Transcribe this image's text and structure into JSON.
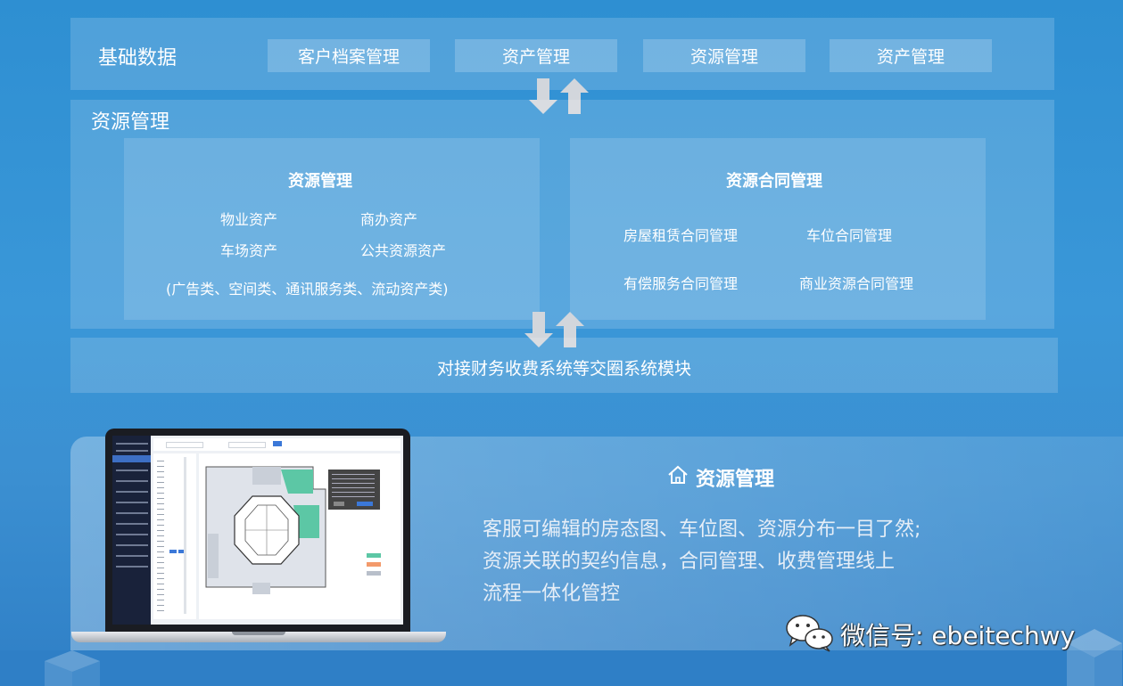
{
  "top_section": {
    "title": "基础数据",
    "chips": [
      "客户档案管理",
      "资产管理",
      "资源管理",
      "资产管理"
    ]
  },
  "middle_section": {
    "title": "资源管理",
    "left_card": {
      "title": "资源管理",
      "items": [
        "物业资产",
        "商办资产",
        "车场资产",
        "公共资源资产"
      ],
      "note": "(广告类、空间类、通讯服务类、流动资产类)"
    },
    "right_card": {
      "title": "资源合同管理",
      "items": [
        "房屋租赁合同管理",
        "车位合同管理",
        "有偿服务合同管理",
        "商业资源合同管理"
      ]
    }
  },
  "bottom_bar": {
    "label": "对接财务收费系统等交圈系统模块"
  },
  "feature": {
    "icon": "home-icon",
    "title": "资源管理",
    "description_lines": [
      "客服可编辑的房态图、车位图、资源分布一目了然;",
      "资源关联的契约信息，合同管理、收费管理线上",
      "流程一体化管控"
    ]
  },
  "watermark": {
    "icon": "wechat-icon",
    "text": "微信号: ebeitechwy"
  },
  "colors": {
    "background": "#3a97d8",
    "floorplan_green": "#5cc7a5",
    "floorplan_orange": "#f39a6b",
    "floorplan_gray": "#b8bfca",
    "arrow_gray": "#d2d6dc"
  }
}
